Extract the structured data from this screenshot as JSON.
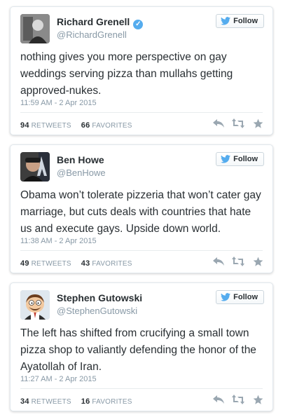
{
  "colors": {
    "twitter_blue": "#55acee",
    "muted": "#8899a6",
    "text": "#292f33",
    "action_icon": "#9aa7b1"
  },
  "icons": {
    "verified": "verified-badge-icon",
    "follow": "twitter-bird-icon",
    "reply": "reply-icon",
    "retweet": "retweet-icon",
    "favorite": "star-icon"
  },
  "follow_label": "Follow",
  "retweets_label": "RETWEETS",
  "favorites_label": "FAVORITES",
  "tweets": [
    {
      "name": "Richard Grenell",
      "verified": true,
      "handle": "@RichardGrenell",
      "text": "nothing gives you more perspective on gay weddings serving pizza than mullahs getting approved-nukes.",
      "time": "11:59 AM - 2 Apr 2015",
      "retweets": "94",
      "favorites": "66"
    },
    {
      "name": "Ben Howe",
      "verified": false,
      "handle": "@BenHowe",
      "text": "Obama won’t tolerate pizzeria that won’t cater gay marriage, but cuts deals with countries that hate us and execute gays. Upside down world.",
      "time": "11:38 AM - 2 Apr 2015",
      "retweets": "49",
      "favorites": "43"
    },
    {
      "name": "Stephen Gutowski",
      "verified": false,
      "handle": "@StephenGutowski",
      "text": "The left has shifted from crucifying a small town pizza shop to valiantly defending the honor of the Ayatollah of Iran.",
      "time": "11:27 AM - 2 Apr 2015",
      "retweets": "34",
      "favorites": "16"
    }
  ]
}
